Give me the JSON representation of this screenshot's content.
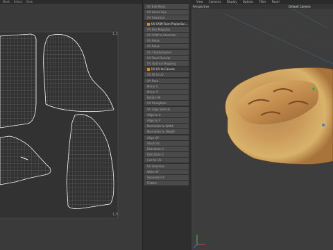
{
  "uv_editor": {
    "menu": [
      "Mesh",
      "Select",
      "View"
    ],
    "corner_label_tr": "1,1",
    "corner_label_br": "1,0"
  },
  "tools_panel": {
    "items": [
      {
        "label": "UV Edit Mesh",
        "header": false
      },
      {
        "label": "UV Island Ops",
        "header": false
      },
      {
        "label": "UV Selection",
        "header": false
      },
      {
        "label": "UV UVW From Projection...",
        "header": true
      },
      {
        "label": "UV Box Mapping",
        "header": false
      },
      {
        "label": "UV UVW to Selection",
        "header": false
      },
      {
        "label": "UV Relax",
        "header": false
      },
      {
        "label": "UV Relax",
        "header": false
      },
      {
        "label": "UV Checkerboard",
        "header": false
      },
      {
        "label": "UV Texel Density",
        "header": false
      },
      {
        "label": "UV Optimal Mapping",
        "header": false
      },
      {
        "label": "UV UV to Canvas",
        "header": true
      },
      {
        "label": "UV Fit to UV",
        "header": false
      },
      {
        "label": "UV Pack",
        "header": false
      },
      {
        "label": "Mirror U",
        "header": false
      },
      {
        "label": "Mirror V",
        "header": false
      },
      {
        "label": "Rotate 90",
        "header": false
      },
      {
        "label": "UV Straighten",
        "header": false
      },
      {
        "label": "UV Align Vertical",
        "header": false
      },
      {
        "label": "Align to U",
        "header": false
      },
      {
        "label": "Align to V",
        "header": false
      },
      {
        "label": "Normalize to Width",
        "header": false
      },
      {
        "label": "Normalize to Height",
        "header": false
      },
      {
        "label": "Align UV",
        "header": false
      },
      {
        "label": "Stack UV",
        "header": false
      },
      {
        "label": "Distribute U",
        "header": false
      },
      {
        "label": "Distribute V",
        "header": false
      },
      {
        "label": "Cut for UV",
        "header": false
      },
      {
        "label": "Fill Selection",
        "header": false
      },
      {
        "label": "Weld UV",
        "header": false
      },
      {
        "label": "Separate UV",
        "header": false
      },
      {
        "label": "Flatten",
        "header": false
      }
    ]
  },
  "viewport": {
    "menu": [
      "View",
      "Cameras",
      "Display",
      "Options",
      "Filter",
      "Panel"
    ],
    "view_name": "Perspective",
    "camera": "Default Camera"
  }
}
